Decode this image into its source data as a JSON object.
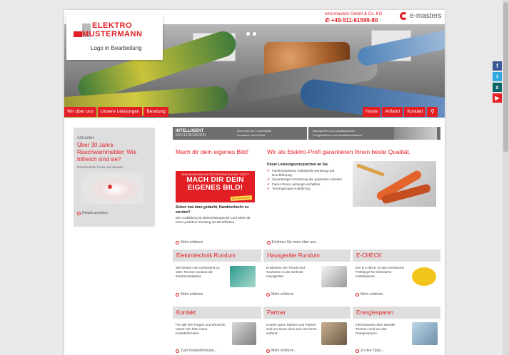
{
  "header": {
    "company_small": "ems.masters GmbH & Co. KG",
    "phone": "+49-511-61599-80",
    "brand": "e-masters"
  },
  "logo": {
    "line1": "ELEKTRO",
    "line2": "MUSTERMANN",
    "line3": "Logo in Bearbeitung"
  },
  "social": [
    {
      "icon": "facebook-icon",
      "glyph": "f",
      "color": "#3b5998"
    },
    {
      "icon": "twitter-icon",
      "glyph": "t",
      "color": "#2fa8e1"
    },
    {
      "icon": "xing-icon",
      "glyph": "x",
      "color": "#0a6468"
    },
    {
      "icon": "youtube-icon",
      "glyph": "▶",
      "color": "#e31e24"
    }
  ],
  "nav": {
    "left": [
      "Wir über uns",
      "Unsere Leistungen",
      "Beratung"
    ],
    "right": [
      "Home",
      "Anfahrt",
      "Kontakt"
    ]
  },
  "news": {
    "label": "Aktuelles",
    "title": "Über 30 Jahre Rauchwarnmelder: Wie hilfreich sind sie?",
    "subtitle": "Rauchmelder heute und damals",
    "more": "Details ansehen"
  },
  "banner": {
    "title1": "INTELLIGENT",
    "title2": "MODERNISIEREN",
    "col1": [
      "Sicherheit und Funktionalität",
      "Innovation und Komfort"
    ],
    "col2": [
      "Altersgerecht und zukunftsorientiert",
      "Energieeffizienz und Umweltbewusstsein"
    ]
  },
  "career": {
    "heading": "Mach dir dein eigenes Bild!",
    "promo_small": "SEHR ANLEIHUNG HEUTE FÜR DEINE ZUKUNFT STATT?",
    "promo_big": "MACH DIR DEIN EIGENES BILD!",
    "promo_tag": "jetzt informieren!",
    "question": "Schon mal dran gedacht, Handwerker/in zu werden?",
    "text": "Die Ausbildung ist abwechslungsreich und bietet dir einen perfekten Einstieg ins Berufsleben.",
    "more": "Mehr erfahren"
  },
  "quality": {
    "heading": "Wir als Elektro-Profi garantieren Ihnen beste Qualität.",
    "intro": "Unser Leistungsversprechen an Sie.",
    "items": [
      "Fachkompetente individuelle Beratung und Durchführung",
      "Zuverlässige Umsetzung der geplanten Arbeiten",
      "Faires Preis-Leistungs-Verhältnis",
      "Termingenaue Ausführung"
    ],
    "more": "Erfahren Sie mehr über uns..."
  },
  "tiles_row1": [
    {
      "title": "Elektrotechnik Rundum",
      "text": "Wir beraten Sie umfassend zu allen Themen rundum die Elektroinstallation.",
      "more": "Mehr erfahren"
    },
    {
      "title": "Hausgeräte Rundum",
      "text": "Entdecken Sie Trends und Neuheiten in der Welt der Hausgeräte.",
      "more": "Mehr erfahren"
    },
    {
      "title": "E-CHECK",
      "text": "Der E-CHECK ist das anerkannte Prüfsiegel für elektrische Installationen.",
      "more": "Mehr erfahren"
    }
  ],
  "tiles_row2": [
    {
      "title": "Kontakt",
      "text": "Für alle Ihre Fragen und Wünsche nutzen Sie bitte unser Kontaktformular.",
      "more": "Zum Kontaktformular..."
    },
    {
      "title": "Partner",
      "text": "Unsere guten Marken und Partner sind nur einen Klick weit von Ihnen entfernt.",
      "more": "Mehr erfahren..."
    },
    {
      "title": "Energiesparen",
      "text": "Informationen über aktuelle Themen rund um das Energiesparen.",
      "more": "Zu den Tipps..."
    }
  ],
  "colors": {
    "accent": "#e31e24",
    "panel": "#dedede",
    "banner": "#6f6f6f"
  }
}
